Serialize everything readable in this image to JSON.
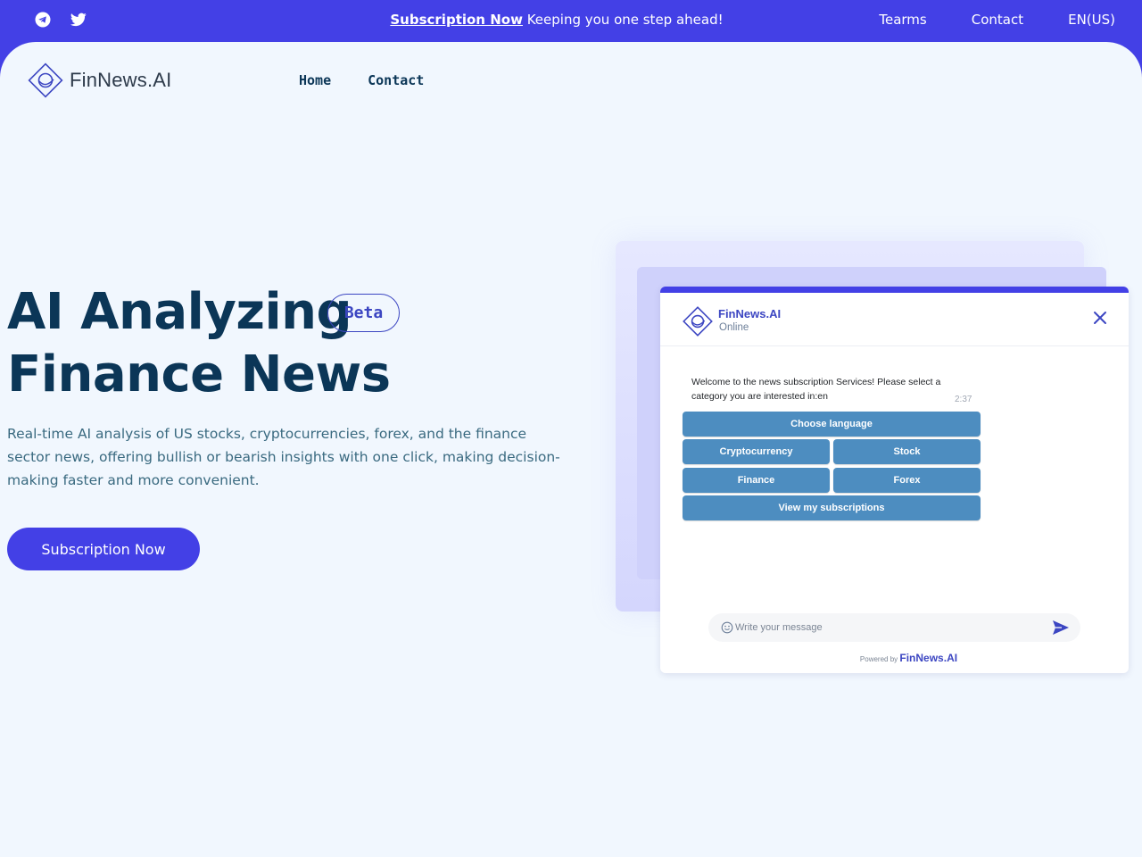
{
  "topbar": {
    "social": [
      {
        "icon": "telegram-icon"
      },
      {
        "icon": "twitter-icon"
      }
    ],
    "promo_link": "Subscription Now",
    "promo_text": " Keeping you one step ahead!",
    "links": [
      "Tearms",
      "Contact",
      "EN(US)"
    ]
  },
  "header": {
    "logo_text": "FinNews.AI",
    "nav": [
      "Home",
      "Contact"
    ]
  },
  "hero": {
    "title_line1": "AI Analyzing",
    "title_line2": "Finance News",
    "badge": "Beta",
    "description": "Real-time AI analysis of US stocks, cryptocurrencies, forex, and the finance sector news, offering bullish or bearish insights with one click, making decision-making faster and more convenient.",
    "cta": "Subscription Now"
  },
  "widget": {
    "name": "FinNews.AI",
    "status": "Online",
    "message": "Welcome to the news subscription Services! Please select a category you are interested in:en",
    "time": "2:37",
    "options": {
      "language": "Choose language",
      "crypto": "Cryptocurrency",
      "stock": "Stock",
      "finance": "Finance",
      "forex": "Forex",
      "subscriptions": "View my subscriptions"
    },
    "input_placeholder": "Write your message",
    "powered_by": "Powered by ",
    "powered_brand": "FinNews.AI"
  },
  "colors": {
    "brand": "#4340e6",
    "heading": "#0b3657",
    "option_button": "#4d8dc0",
    "page_bg": "#f1f7fe"
  }
}
